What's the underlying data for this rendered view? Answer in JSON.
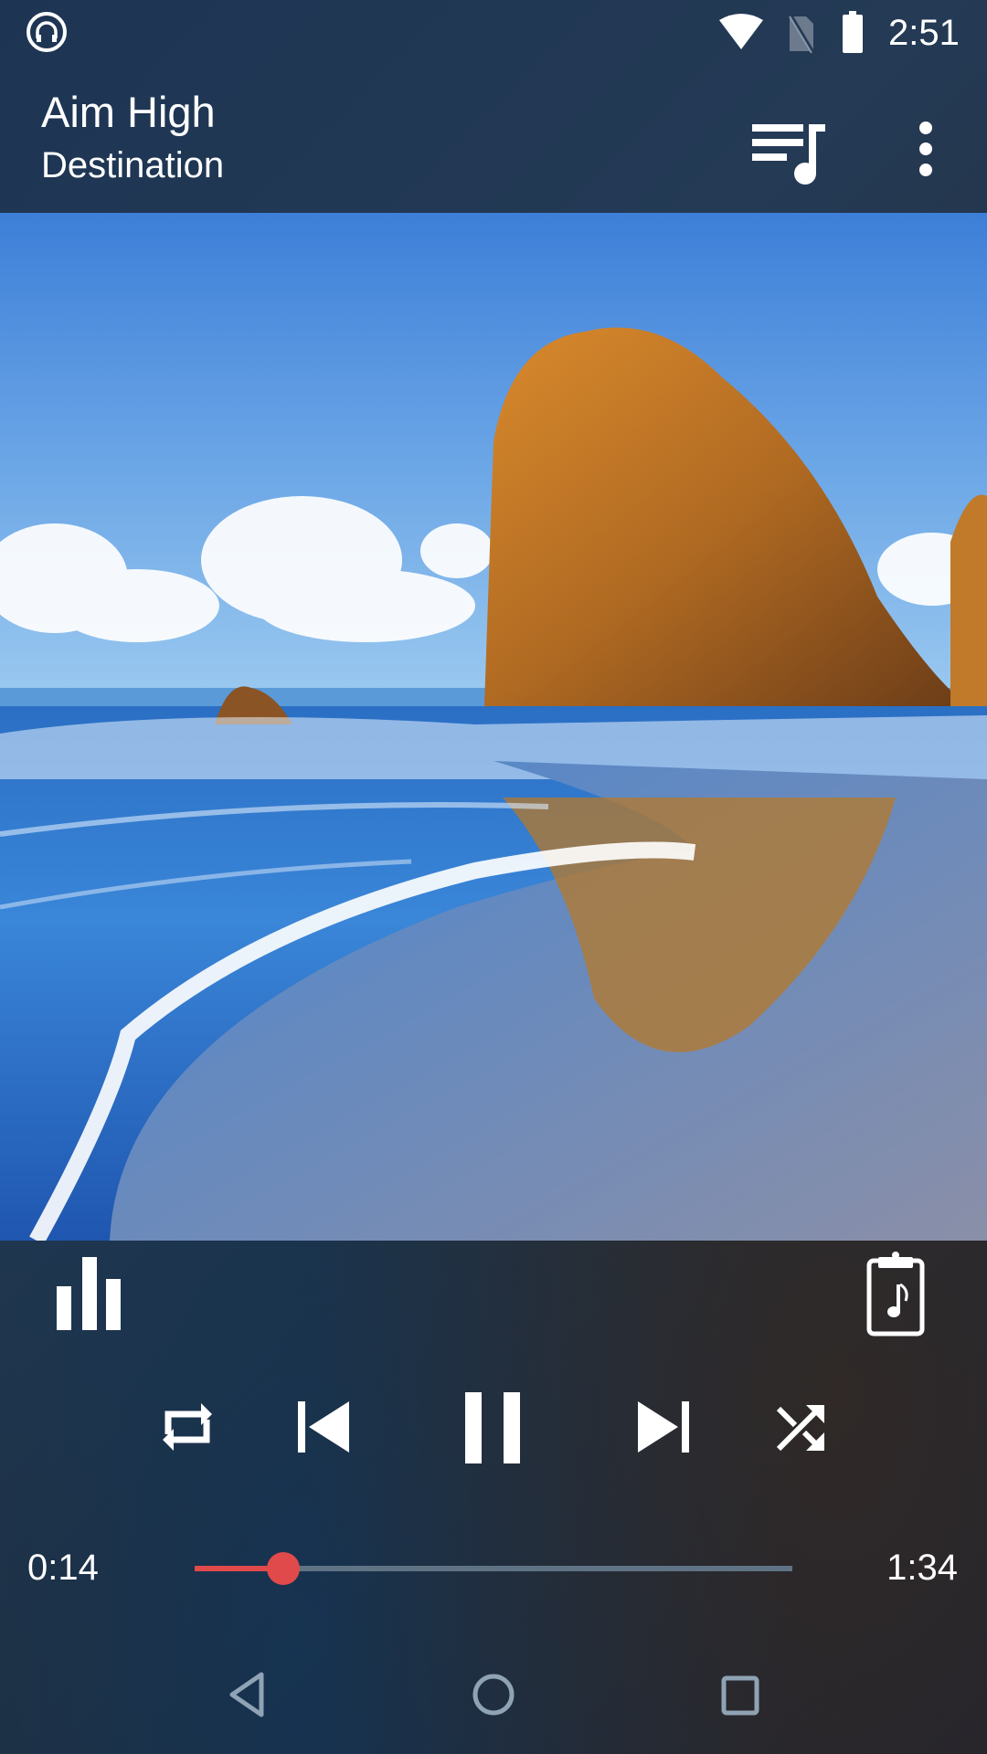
{
  "status_bar": {
    "time": "2:51",
    "icons": [
      "headphones-icon",
      "wifi-icon",
      "no-sim-icon",
      "battery-icon"
    ]
  },
  "header": {
    "title": "Aim High",
    "subtitle": "Destination",
    "actions": [
      "queue-music-icon",
      "more-vert-icon"
    ]
  },
  "album_art": {
    "description": "Coastal beach with large orange sea stack rock, blue sky with clouds, and ocean waves reflecting the rock"
  },
  "toolbar": {
    "left_icon": "equalizer-icon",
    "right_icon": "lyrics-clipboard-icon"
  },
  "controls": {
    "buttons": [
      "repeat-icon",
      "skip-previous-icon",
      "pause-icon",
      "skip-next-icon",
      "shuffle-icon"
    ]
  },
  "playback": {
    "current_time": "0:14",
    "total_time": "1:34",
    "progress_fraction": 0.149
  },
  "colors": {
    "accent": "#e04a4a",
    "track": "#5f7385",
    "nav_icons": "#8fa3b5"
  },
  "navbar": {
    "buttons": [
      "back-icon",
      "home-icon",
      "recents-icon"
    ]
  }
}
